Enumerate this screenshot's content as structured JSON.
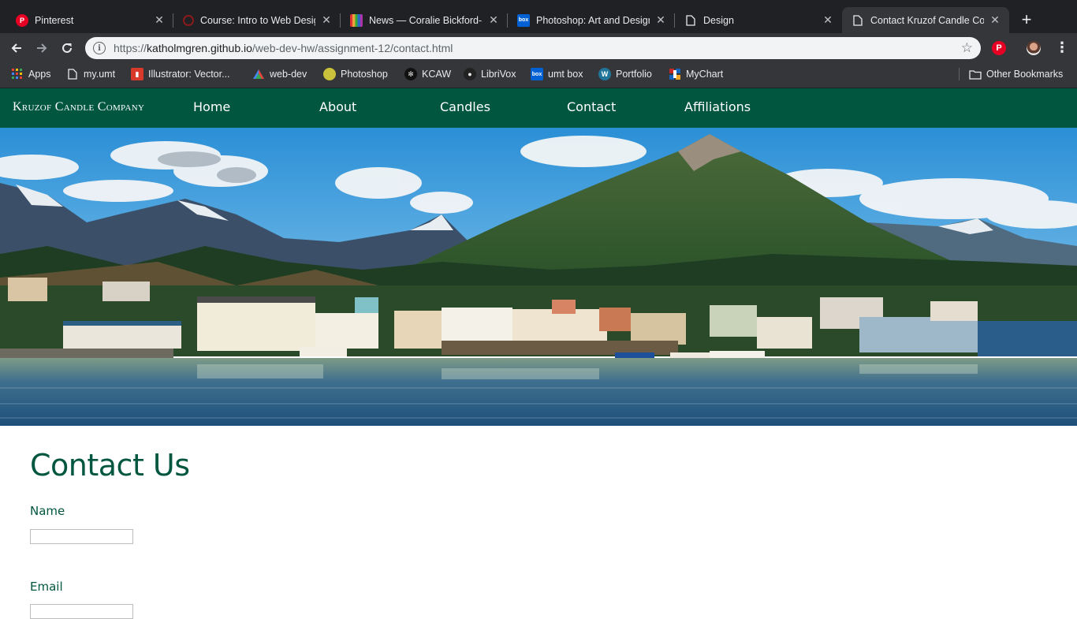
{
  "browser": {
    "tabs": [
      {
        "title": "Pinterest",
        "icon": "pinterest-icon",
        "color": "#e60023"
      },
      {
        "title": "Course: Intro to Web Design",
        "icon": "course-icon",
        "color": "#8b1a1a"
      },
      {
        "title": "News — Coralie Bickford-Smith",
        "icon": "news-icon",
        "color": "#e8a33d"
      },
      {
        "title": "Photoshop: Art and Design",
        "icon": "box-icon",
        "color": "#0061d5"
      },
      {
        "title": "Design",
        "icon": "page-icon",
        "color": "#e8eaed"
      },
      {
        "title": "Contact Kruzof Candle Company",
        "icon": "page-icon",
        "color": "#e8eaed"
      }
    ],
    "url_prefix": "https://",
    "url_domain": "katholmgren.github.io",
    "url_path": "/web-dev-hw/assignment-12/contact.html",
    "bookmarks": [
      {
        "label": "Apps",
        "icon": "apps-grid-icon"
      },
      {
        "label": "my.umt",
        "icon": "page-icon"
      },
      {
        "label": "Illustrator: Vector...",
        "icon": "illustrator-icon"
      },
      {
        "label": "web-dev",
        "icon": "web-dev-icon"
      },
      {
        "label": "Photoshop",
        "icon": "photoshop-icon"
      },
      {
        "label": "KCAW",
        "icon": "kcaw-icon"
      },
      {
        "label": "LibriVox",
        "icon": "librivox-icon"
      },
      {
        "label": "umt box",
        "icon": "box-icon"
      },
      {
        "label": "Portfolio",
        "icon": "wordpress-icon"
      },
      {
        "label": "MyChart",
        "icon": "mychart-icon"
      }
    ],
    "other_bookmarks": "Other Bookmarks"
  },
  "site": {
    "brand": "Kruzof Candle Company",
    "nav": [
      "Home",
      "About",
      "Candles",
      "Contact",
      "Affiliations"
    ],
    "accent_color": "#00563f"
  },
  "contact": {
    "heading": "Contact Us",
    "name_label": "Name",
    "name_value": "",
    "email_label": "Email",
    "email_value": ""
  }
}
